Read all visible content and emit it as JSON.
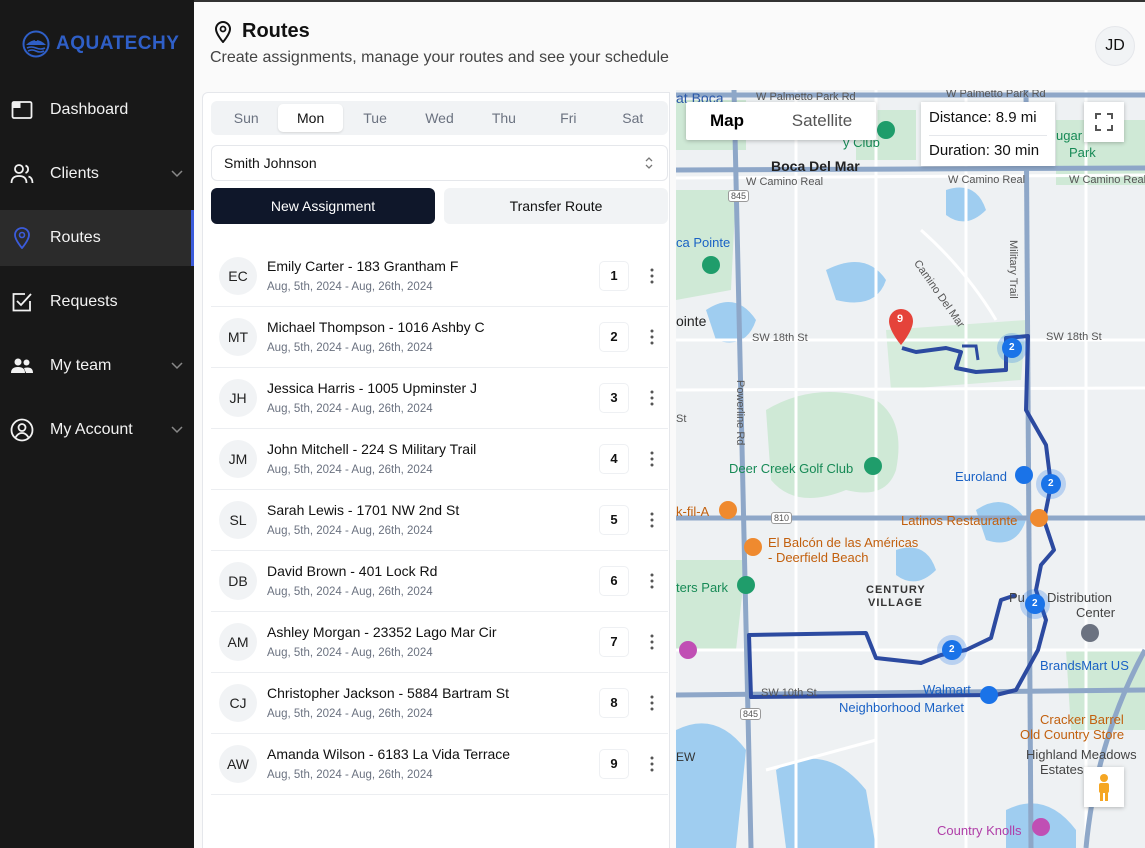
{
  "app": {
    "brand": "AQUATECHY"
  },
  "sidebar": {
    "items": [
      {
        "label": "Dashboard",
        "icon": "dashboard-icon"
      },
      {
        "label": "Clients",
        "icon": "users-icon",
        "expandable": true
      },
      {
        "label": "Routes",
        "icon": "map-pin-icon",
        "active": true
      },
      {
        "label": "Requests",
        "icon": "checkbox-icon"
      },
      {
        "label": "My team",
        "icon": "team-icon",
        "expandable": true
      },
      {
        "label": "My Account",
        "icon": "user-circle-icon",
        "expandable": true
      }
    ]
  },
  "header": {
    "title": "Routes",
    "subtitle": "Create assignments, manage your routes and see your schedule",
    "avatar_initials": "JD"
  },
  "days": {
    "items": [
      "Sun",
      "Mon",
      "Tue",
      "Wed",
      "Thu",
      "Fri",
      "Sat"
    ],
    "selected": "Mon"
  },
  "client_select": {
    "value": "Smith Johnson"
  },
  "actions": {
    "new_assignment": "New Assignment",
    "transfer_route": "Transfer Route"
  },
  "assignments": [
    {
      "initials": "EC",
      "title": "Emily Carter - 183 Grantham F",
      "dates": "Aug, 5th, 2024 - Aug, 26th, 2024",
      "order": "1"
    },
    {
      "initials": "MT",
      "title": "Michael Thompson - 1016 Ashby C",
      "dates": "Aug, 5th, 2024 - Aug, 26th, 2024",
      "order": "2"
    },
    {
      "initials": "JH",
      "title": "Jessica Harris - 1005 Upminster J",
      "dates": "Aug, 5th, 2024 - Aug, 26th, 2024",
      "order": "3"
    },
    {
      "initials": "JM",
      "title": "John Mitchell - 224 S Military Trail",
      "dates": "Aug, 5th, 2024 - Aug, 26th, 2024",
      "order": "4"
    },
    {
      "initials": "SL",
      "title": "Sarah Lewis - 1701 NW 2nd St",
      "dates": "Aug, 5th, 2024 - Aug, 26th, 2024",
      "order": "5"
    },
    {
      "initials": "DB",
      "title": "David Brown - 401 Lock Rd",
      "dates": "Aug, 5th, 2024 - Aug, 26th, 2024",
      "order": "6"
    },
    {
      "initials": "AM",
      "title": "Ashley Morgan - 23352 Lago Mar Cir",
      "dates": "Aug, 5th, 2024 - Aug, 26th, 2024",
      "order": "7"
    },
    {
      "initials": "CJ",
      "title": "Christopher Jackson - 5884 Bartram St",
      "dates": "Aug, 5th, 2024 - Aug, 26th, 2024",
      "order": "8"
    },
    {
      "initials": "AW",
      "title": "Amanda Wilson - 6183 La Vida Terrace",
      "dates": "Aug, 5th, 2024 - Aug, 26th, 2024",
      "order": "9"
    }
  ],
  "map": {
    "toggle_map": "Map",
    "toggle_satellite": "Satellite",
    "distance": "Distance: 8.9 mi",
    "duration": "Duration: 30 min",
    "route_color": "#2c4aa0",
    "cluster_color": "#1a73e8",
    "marker_label": "9",
    "cluster_labels": [
      "2",
      "2",
      "2",
      "2"
    ],
    "labels": {
      "boca_raton": "at Boca",
      "w_palmetto_1": "W Palmetto Park Rd",
      "w_palmetto_2": "W Palmetto Park Rd",
      "city_club": "y Club",
      "sugar": "ugar",
      "park": "Park",
      "boca_del_mar": "Boca Del Mar",
      "w_camino_1": "W Camino Real",
      "w_camino_2": "W Camino Real",
      "w_camino_3": "W Camino Real",
      "boca_pointe": "ca Pointe",
      "camino_del_mar": "Camino Del Mar",
      "military_trail": "Military Trail",
      "pointe": "ointe",
      "sw18_1": "SW 18th St",
      "sw18_2": "SW 18th St",
      "st": "St",
      "powerline": "Powerline Rd",
      "deer_creek": "Deer Creek Golf Club",
      "euroland": "Euroland",
      "chick": "k-fil-A",
      "latinos": "Latinos Restaurante",
      "balcon_1": "El Balcón de las Américas",
      "balcon_2": "- Deerfield Beach",
      "century_1": "CENTURY",
      "century_2": "VILLAGE",
      "ters_park": "ters Park",
      "pub_dist_1": "Pu",
      "pub_dist_2": "Distribution",
      "center": "Center",
      "brandsmart": "BrandsMart US",
      "walmart": "Walmart",
      "neighborhood": "Neighborhood Market",
      "sw_10": "SW 10th St",
      "cracker": "Cracker Barrel",
      "old_country": "Old Country Store",
      "highland_1": "Highland Meadows",
      "estates": "Estates",
      "country_knolls": "Country Knolls",
      "ew": "EW",
      "r845_1": "845",
      "r845_2": "845",
      "r810": "810"
    }
  }
}
